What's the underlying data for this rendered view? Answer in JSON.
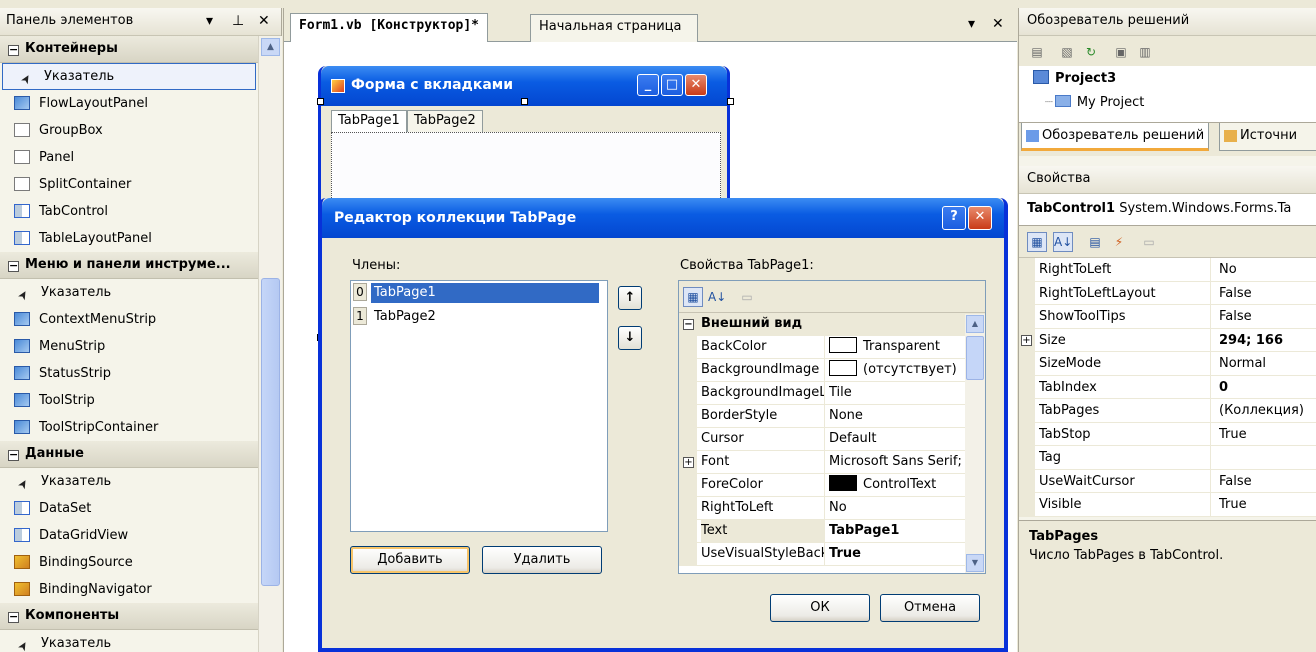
{
  "toolbox": {
    "title": "Панель элементов",
    "ctl_dropdown": "▾",
    "ctl_pin": "ꟷ",
    "ctl_close": "✕",
    "categories": [
      {
        "label": "Контейнеры",
        "items": [
          {
            "label": "Указатель",
            "icon": "pointer-icon",
            "selected": true
          },
          {
            "label": "FlowLayoutPanel",
            "icon": "flowlayoutpanel-icon"
          },
          {
            "label": "GroupBox",
            "icon": "groupbox-icon"
          },
          {
            "label": "Panel",
            "icon": "panel-icon"
          },
          {
            "label": "SplitContainer",
            "icon": "splitcontainer-icon"
          },
          {
            "label": "TabControl",
            "icon": "tabcontrol-icon"
          },
          {
            "label": "TableLayoutPanel",
            "icon": "tablelayoutpanel-icon"
          }
        ]
      },
      {
        "label": "Меню и панели инструме...",
        "items": [
          {
            "label": "Указатель",
            "icon": "pointer-icon"
          },
          {
            "label": "ContextMenuStrip",
            "icon": "contextmenustrip-icon"
          },
          {
            "label": "MenuStrip",
            "icon": "menustrip-icon"
          },
          {
            "label": "StatusStrip",
            "icon": "statusstrip-icon"
          },
          {
            "label": "ToolStrip",
            "icon": "toolstrip-icon"
          },
          {
            "label": "ToolStripContainer",
            "icon": "toolstripcontainer-icon"
          }
        ]
      },
      {
        "label": "Данные",
        "items": [
          {
            "label": "Указатель",
            "icon": "pointer-icon"
          },
          {
            "label": "DataSet",
            "icon": "dataset-icon"
          },
          {
            "label": "DataGridView",
            "icon": "datagridview-icon"
          },
          {
            "label": "BindingSource",
            "icon": "bindingsource-icon"
          },
          {
            "label": "BindingNavigator",
            "icon": "bindingnavigator-icon"
          }
        ]
      },
      {
        "label": "Компоненты",
        "items": [
          {
            "label": "Указатель",
            "icon": "pointer-icon"
          }
        ]
      }
    ]
  },
  "document": {
    "tabs": [
      {
        "label": "Form1.vb [Конструктор]*",
        "active": true
      },
      {
        "label": "Начальная страница",
        "active": false
      }
    ],
    "ctl_dropdown": "▾",
    "ctl_close": "✕",
    "form": {
      "title": "Форма с вкладками",
      "tabs": [
        "TabPage1",
        "TabPage2"
      ],
      "btn_min": "_",
      "btn_max": "□",
      "btn_close": "✕"
    }
  },
  "dialog": {
    "title": "Редактор коллекции TabPage",
    "help_btn": "?",
    "close_btn": "✕",
    "members_label": "Члены:",
    "members": [
      {
        "index": "0",
        "name": "TabPage1",
        "selected": true
      },
      {
        "index": "1",
        "name": "TabPage2",
        "selected": false
      }
    ],
    "move_up": "↑",
    "move_down": "↓",
    "add_btn": "Добавить",
    "remove_btn": "Удалить",
    "props_label": "Свойства TabPage1:",
    "category": "Внешний вид",
    "properties": [
      {
        "name": "BackColor",
        "value": "Transparent",
        "swatch": "#ffffff"
      },
      {
        "name": "BackgroundImage",
        "value": "(отсутствует)",
        "swatch": "#ffffff"
      },
      {
        "name": "BackgroundImageLayout",
        "value": "Tile"
      },
      {
        "name": "BorderStyle",
        "value": "None"
      },
      {
        "name": "Cursor",
        "value": "Default"
      },
      {
        "name": "Font",
        "value": "Microsoft Sans Serif;",
        "expandable": true
      },
      {
        "name": "ForeColor",
        "value": "ControlText",
        "swatch": "#000000"
      },
      {
        "name": "RightToLeft",
        "value": "No"
      },
      {
        "name": "Text",
        "value": "TabPage1",
        "bold": true,
        "selected": true
      },
      {
        "name": "UseVisualStyleBackColor",
        "value": "True",
        "bold": true
      }
    ],
    "ok_btn": "ОК",
    "cancel_btn": "Отмена"
  },
  "solution_explorer": {
    "title": "Обозреватель решений",
    "project": "Project3",
    "child": "My Project",
    "tabs": [
      "Обозреватель решений",
      "Источни"
    ]
  },
  "properties_panel": {
    "title": "Свойства",
    "object_name": "TabControl1",
    "object_type": "System.Windows.Forms.Ta",
    "rows": [
      {
        "name": "RightToLeft",
        "value": "No"
      },
      {
        "name": "RightToLeftLayout",
        "value": "False"
      },
      {
        "name": "ShowToolTips",
        "value": "False"
      },
      {
        "name": "Size",
        "value": "294; 166",
        "bold": true,
        "expandable": true
      },
      {
        "name": "SizeMode",
        "value": "Normal"
      },
      {
        "name": "TabIndex",
        "value": "0",
        "bold": true
      },
      {
        "name": "TabPages",
        "value": "(Коллекция)"
      },
      {
        "name": "TabStop",
        "value": "True"
      },
      {
        "name": "Tag",
        "value": ""
      },
      {
        "name": "UseWaitCursor",
        "value": "False"
      },
      {
        "name": "Visible",
        "value": "True"
      }
    ],
    "desc_title": "TabPages",
    "desc_text": "Число TabPages в TabControl."
  },
  "colors": {
    "xp_blue": "#0a5ce3",
    "selection": "#316ac5",
    "chrome": "#ece9d8"
  }
}
